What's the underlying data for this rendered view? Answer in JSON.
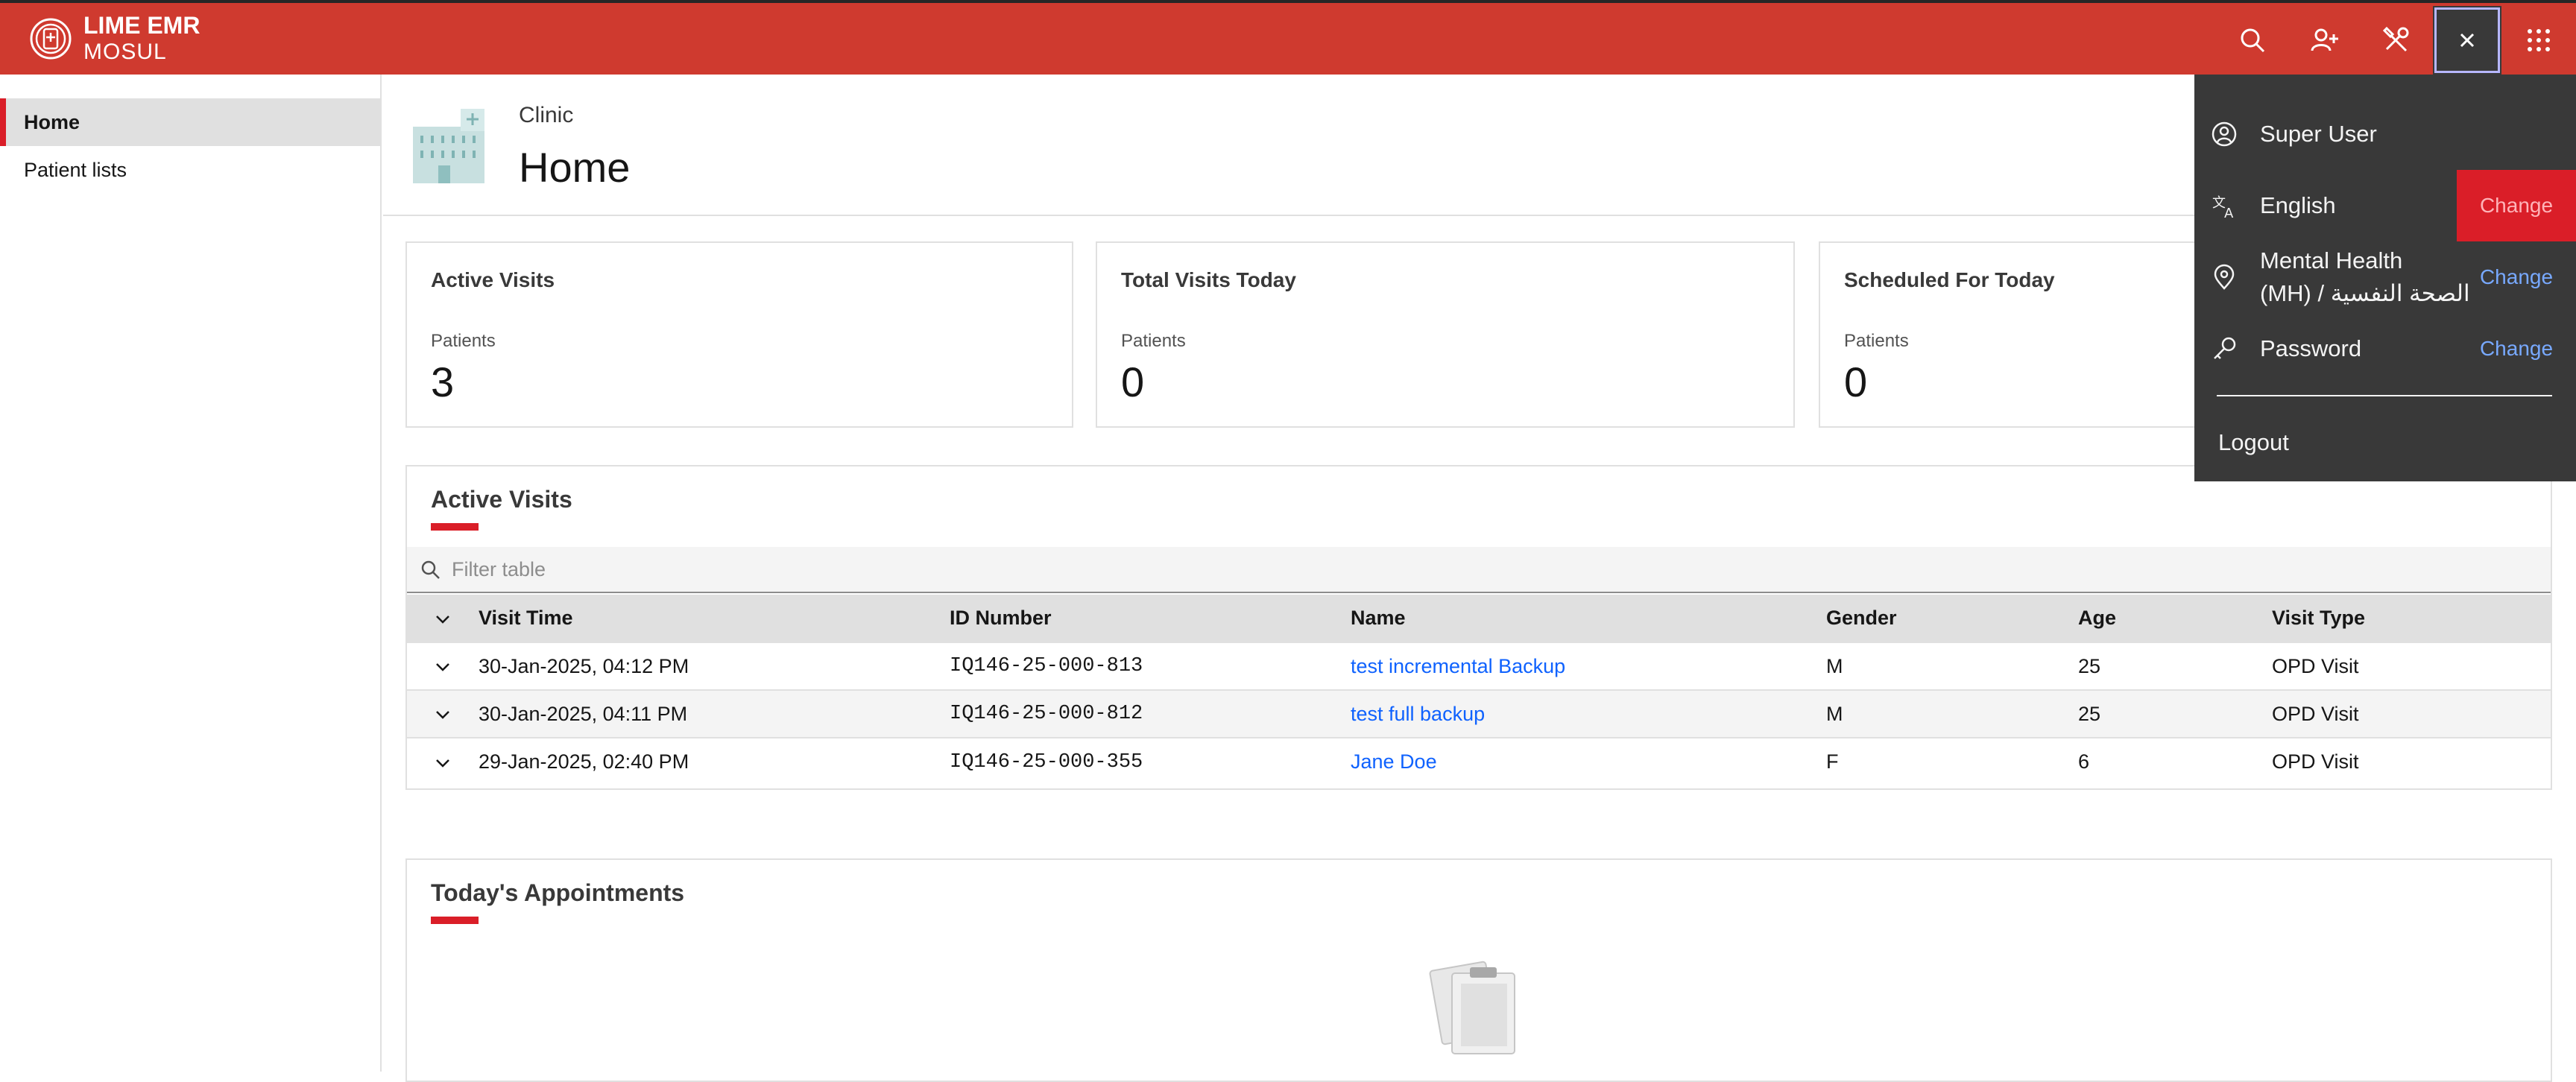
{
  "header": {
    "brand_name": "LIME EMR",
    "brand_sub": "MOSUL",
    "icons": [
      "search-icon",
      "add-patient-icon",
      "tools-icon",
      "close-icon",
      "app-switcher-icon"
    ],
    "color": "#cf3a2f"
  },
  "sidebar": {
    "items": [
      {
        "label": "Home",
        "selected": true
      },
      {
        "label": "Patient lists",
        "selected": false
      }
    ]
  },
  "page": {
    "breadcrumb": "Clinic",
    "title": "Home"
  },
  "metrics": [
    {
      "title": "Active Visits",
      "label": "Patients",
      "value": "3"
    },
    {
      "title": "Total Visits Today",
      "label": "Patients",
      "value": "0"
    },
    {
      "title": "Scheduled For Today",
      "label": "Patients",
      "value": "0"
    }
  ],
  "active_visits": {
    "title": "Active Visits",
    "filter_placeholder": "Filter table",
    "columns": [
      "Visit Time",
      "ID Number",
      "Name",
      "Gender",
      "Age",
      "Visit Type"
    ],
    "rows": [
      {
        "visit_time": "30-Jan-2025, 04:12 PM",
        "id": "IQ146-25-000-813",
        "name": "test incremental Backup",
        "gender": "M",
        "age": "25",
        "visit_type": "OPD Visit"
      },
      {
        "visit_time": "30-Jan-2025, 04:11 PM",
        "id": "IQ146-25-000-812",
        "name": "test full backup",
        "gender": "M",
        "age": "25",
        "visit_type": "OPD Visit"
      },
      {
        "visit_time": "29-Jan-2025, 02:40 PM",
        "id": "IQ146-25-000-355",
        "name": "Jane Doe",
        "gender": "F",
        "age": "6",
        "visit_type": "OPD Visit"
      }
    ]
  },
  "appointments": {
    "title": "Today's Appointments"
  },
  "user_panel": {
    "user": "Super User",
    "language": "English",
    "location_line1": "Mental Health",
    "location_line2": "(MH) / الصحة النفسية",
    "password": "Password",
    "change_label": "Change",
    "logout": "Logout"
  }
}
